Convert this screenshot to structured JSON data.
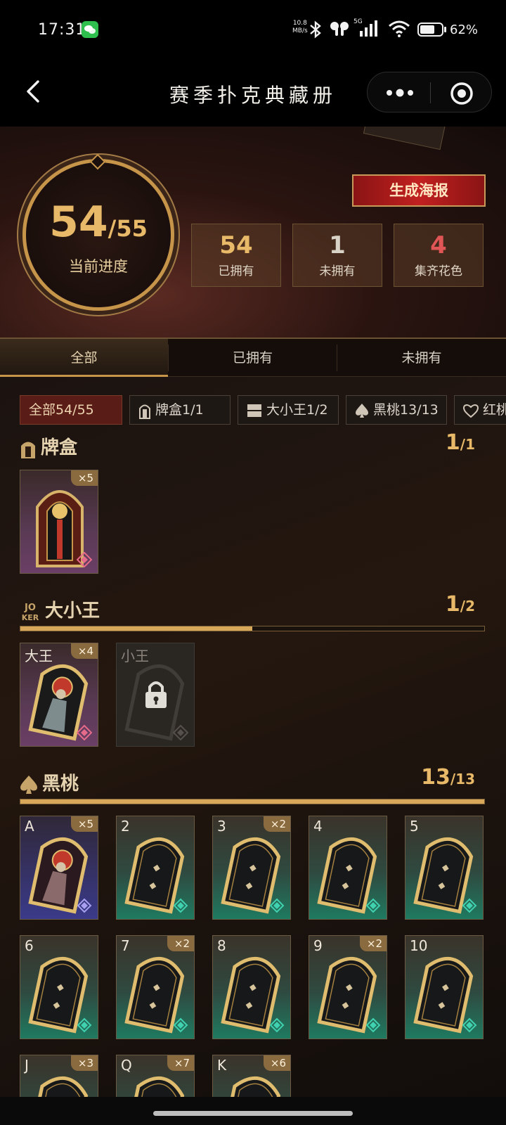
{
  "status_bar": {
    "time": "17:31",
    "net_speed_value": "10.8",
    "net_speed_unit": "MB/s",
    "network": "5G",
    "battery": "62%"
  },
  "nav": {
    "title": "赛季扑克典藏册"
  },
  "progress": {
    "owned": "54",
    "total": "/55",
    "label": "当前进度",
    "value": 0.98
  },
  "poster_button": "生成海报",
  "stats": [
    {
      "value": "54",
      "label": "已拥有"
    },
    {
      "value": "1",
      "label": "未拥有"
    },
    {
      "value": "4",
      "label": "集齐花色"
    }
  ],
  "tabs": [
    "全部",
    "已拥有",
    "未拥有"
  ],
  "filters": [
    {
      "label": "全部54/55",
      "icon": ""
    },
    {
      "label": "牌盒1/1",
      "icon": "card-box-icon"
    },
    {
      "label": "大小王1/2",
      "icon": "joker-icon"
    },
    {
      "label": "黑桃13/13",
      "icon": "spade-icon"
    },
    {
      "label": "红桃",
      "icon": "heart-icon"
    }
  ],
  "sections": {
    "card_box": {
      "title": "牌盒",
      "count": "1",
      "total": "/1",
      "cards": [
        {
          "rank": "",
          "qty": "×5",
          "theme": "purple"
        }
      ]
    },
    "joker": {
      "title": "大小王",
      "count": "1",
      "total": "/2",
      "progress": 0.5,
      "icon_text_top": "JO",
      "icon_text_bottom": "KER",
      "cards": [
        {
          "rank": "大王",
          "qty": "×4",
          "theme": "purple"
        },
        {
          "rank": "小王",
          "qty": "",
          "theme": "locked"
        }
      ]
    },
    "spade": {
      "title": "黑桃",
      "count": "13",
      "total": "/13",
      "progress": 1.0,
      "cards": [
        {
          "rank": "A",
          "qty": "×5",
          "theme": "blue"
        },
        {
          "rank": "2",
          "qty": "",
          "theme": "teal"
        },
        {
          "rank": "3",
          "qty": "×2",
          "theme": "teal"
        },
        {
          "rank": "4",
          "qty": "",
          "theme": "teal"
        },
        {
          "rank": "5",
          "qty": "",
          "theme": "teal"
        },
        {
          "rank": "6",
          "qty": "",
          "theme": "teal"
        },
        {
          "rank": "7",
          "qty": "×2",
          "theme": "teal"
        },
        {
          "rank": "8",
          "qty": "",
          "theme": "teal"
        },
        {
          "rank": "9",
          "qty": "×2",
          "theme": "teal"
        },
        {
          "rank": "10",
          "qty": "",
          "theme": "teal"
        },
        {
          "rank": "J",
          "qty": "×3",
          "theme": "teal"
        },
        {
          "rank": "Q",
          "qty": "×7",
          "theme": "teal"
        },
        {
          "rank": "K",
          "qty": "×6",
          "theme": "teal"
        }
      ]
    }
  },
  "colors": {
    "accent_gold": "#e8b968",
    "poster_red": "#c22020",
    "missing_red": "#e05555"
  }
}
